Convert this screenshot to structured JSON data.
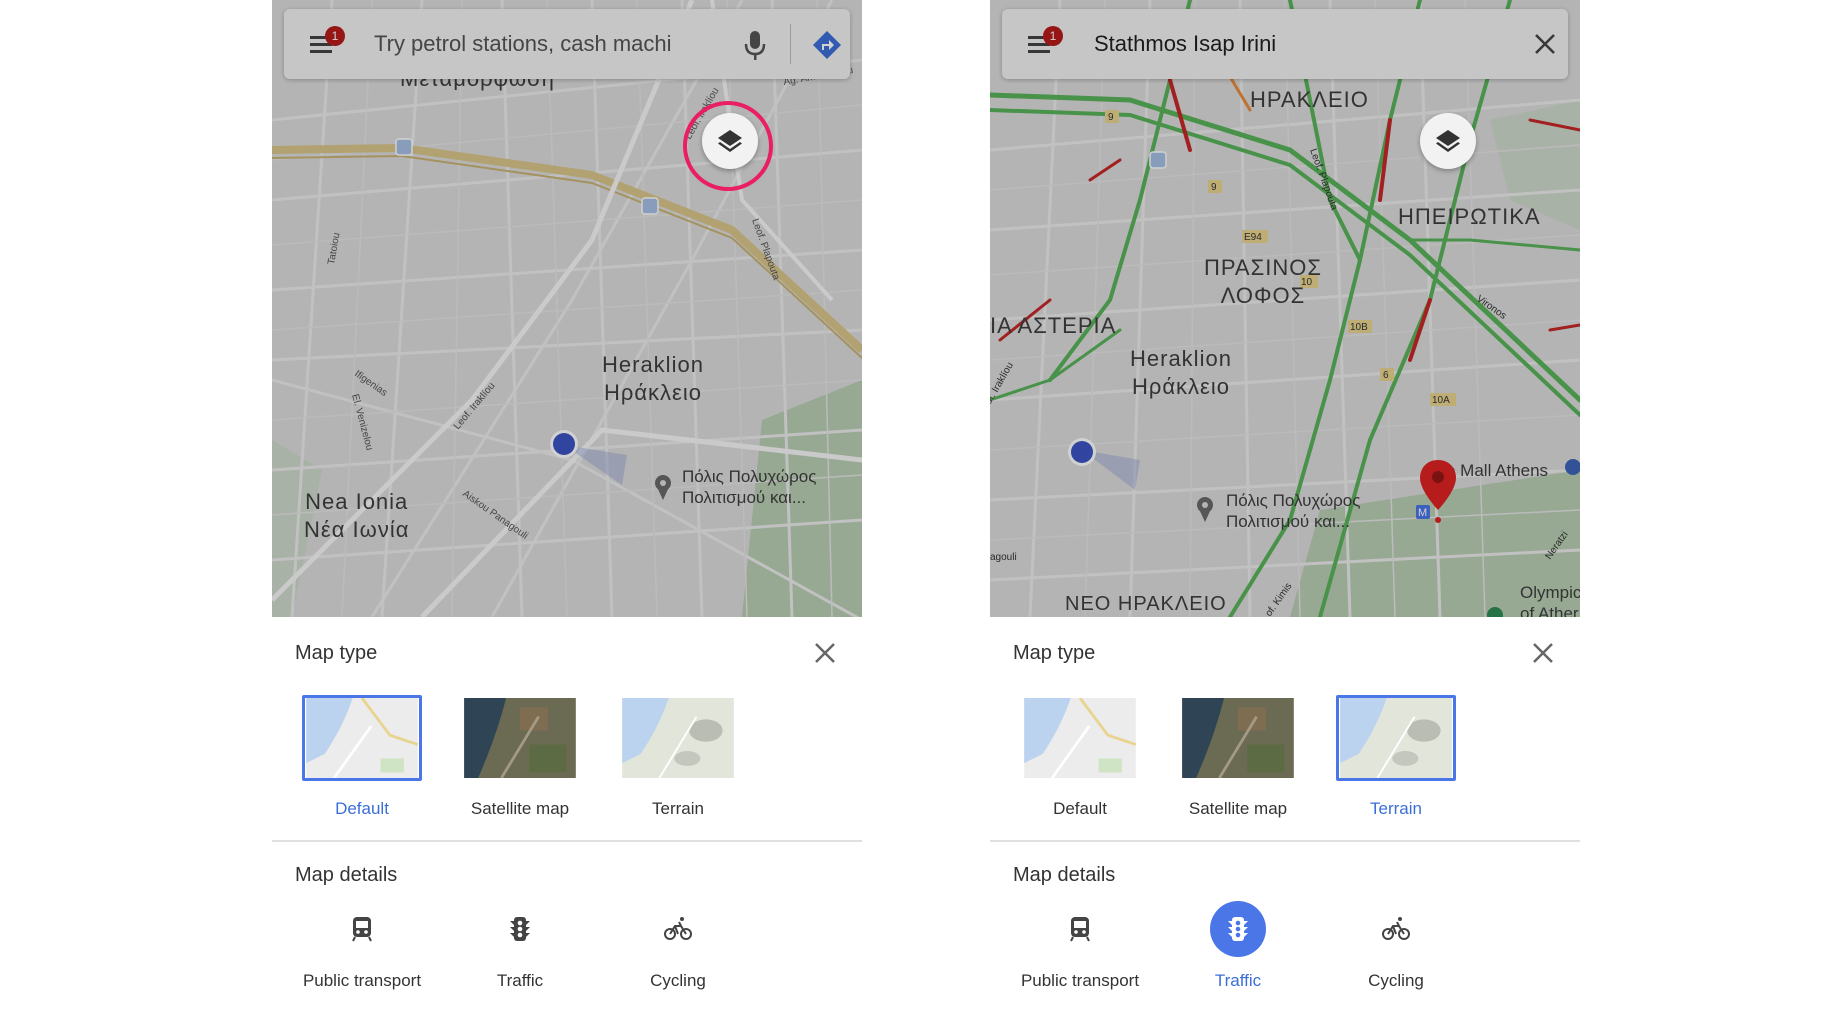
{
  "left": {
    "search": {
      "placeholder": "Try petrol stations, cash machi",
      "badge": "1"
    },
    "map_labels": {
      "metamorfosi": "Μεταμόρφωση",
      "heraklion": "Heraklion\nΗράκλειο",
      "nea_ionia": "Nea Ionia\nΝέα Ιωνία",
      "poi": "Πόλις Πολυχώρος\nΠολιτισμού και..."
    },
    "sheet": {
      "map_type_title": "Map type",
      "types": [
        {
          "label": "Default",
          "selected": true
        },
        {
          "label": "Satellite map",
          "selected": false
        },
        {
          "label": "Terrain",
          "selected": false
        }
      ],
      "map_details_title": "Map details",
      "details": [
        {
          "label": "Public transport",
          "active": false
        },
        {
          "label": "Traffic",
          "active": false
        },
        {
          "label": "Cycling",
          "active": false
        }
      ]
    }
  },
  "right": {
    "search": {
      "query": "Stathmos Isap Irini",
      "badge": "1"
    },
    "map_labels": {
      "herakleio_top": "ΗΡΑΚΛΕΙΟ",
      "ipeirotika": "ΗΠΕΙΡΩΤΙΚΑ",
      "prasinos": "ΠΡΑΣΙΝΟΣ\nΛΟΦΟΣ",
      "asteria": "ΙΑ ΑΣΤΕΡΙΑ",
      "heraklion": "Heraklion\nΗράκλειο",
      "mall": "e Mall Athens",
      "poi": "Πόλις Πολυχώρος\nΠολιτισμού και...",
      "neo_herakleio": "ΝΕΟ ΗΡΑΚΛΕΙΟ",
      "olympic": "Olympic\nof Ather"
    },
    "sheet": {
      "map_type_title": "Map type",
      "types": [
        {
          "label": "Default",
          "selected": false
        },
        {
          "label": "Satellite map",
          "selected": false
        },
        {
          "label": "Terrain",
          "selected": true
        }
      ],
      "map_details_title": "Map details",
      "details": [
        {
          "label": "Public transport",
          "active": false
        },
        {
          "label": "Traffic",
          "active": true
        },
        {
          "label": "Cycling",
          "active": false
        }
      ]
    }
  },
  "colors": {
    "accent": "#4a76e8",
    "highlight_ring": "#e91e63",
    "badge": "#b71c1c",
    "pin": "#b71c1c",
    "traffic_green": "#4caf50",
    "traffic_red": "#c62828"
  },
  "icons": [
    "menu-icon",
    "mic-icon",
    "directions-icon",
    "layers-icon",
    "close-icon",
    "train-icon",
    "traffic-light-icon",
    "bicycle-icon",
    "location-dot-icon",
    "map-pin-icon",
    "place-icon"
  ]
}
